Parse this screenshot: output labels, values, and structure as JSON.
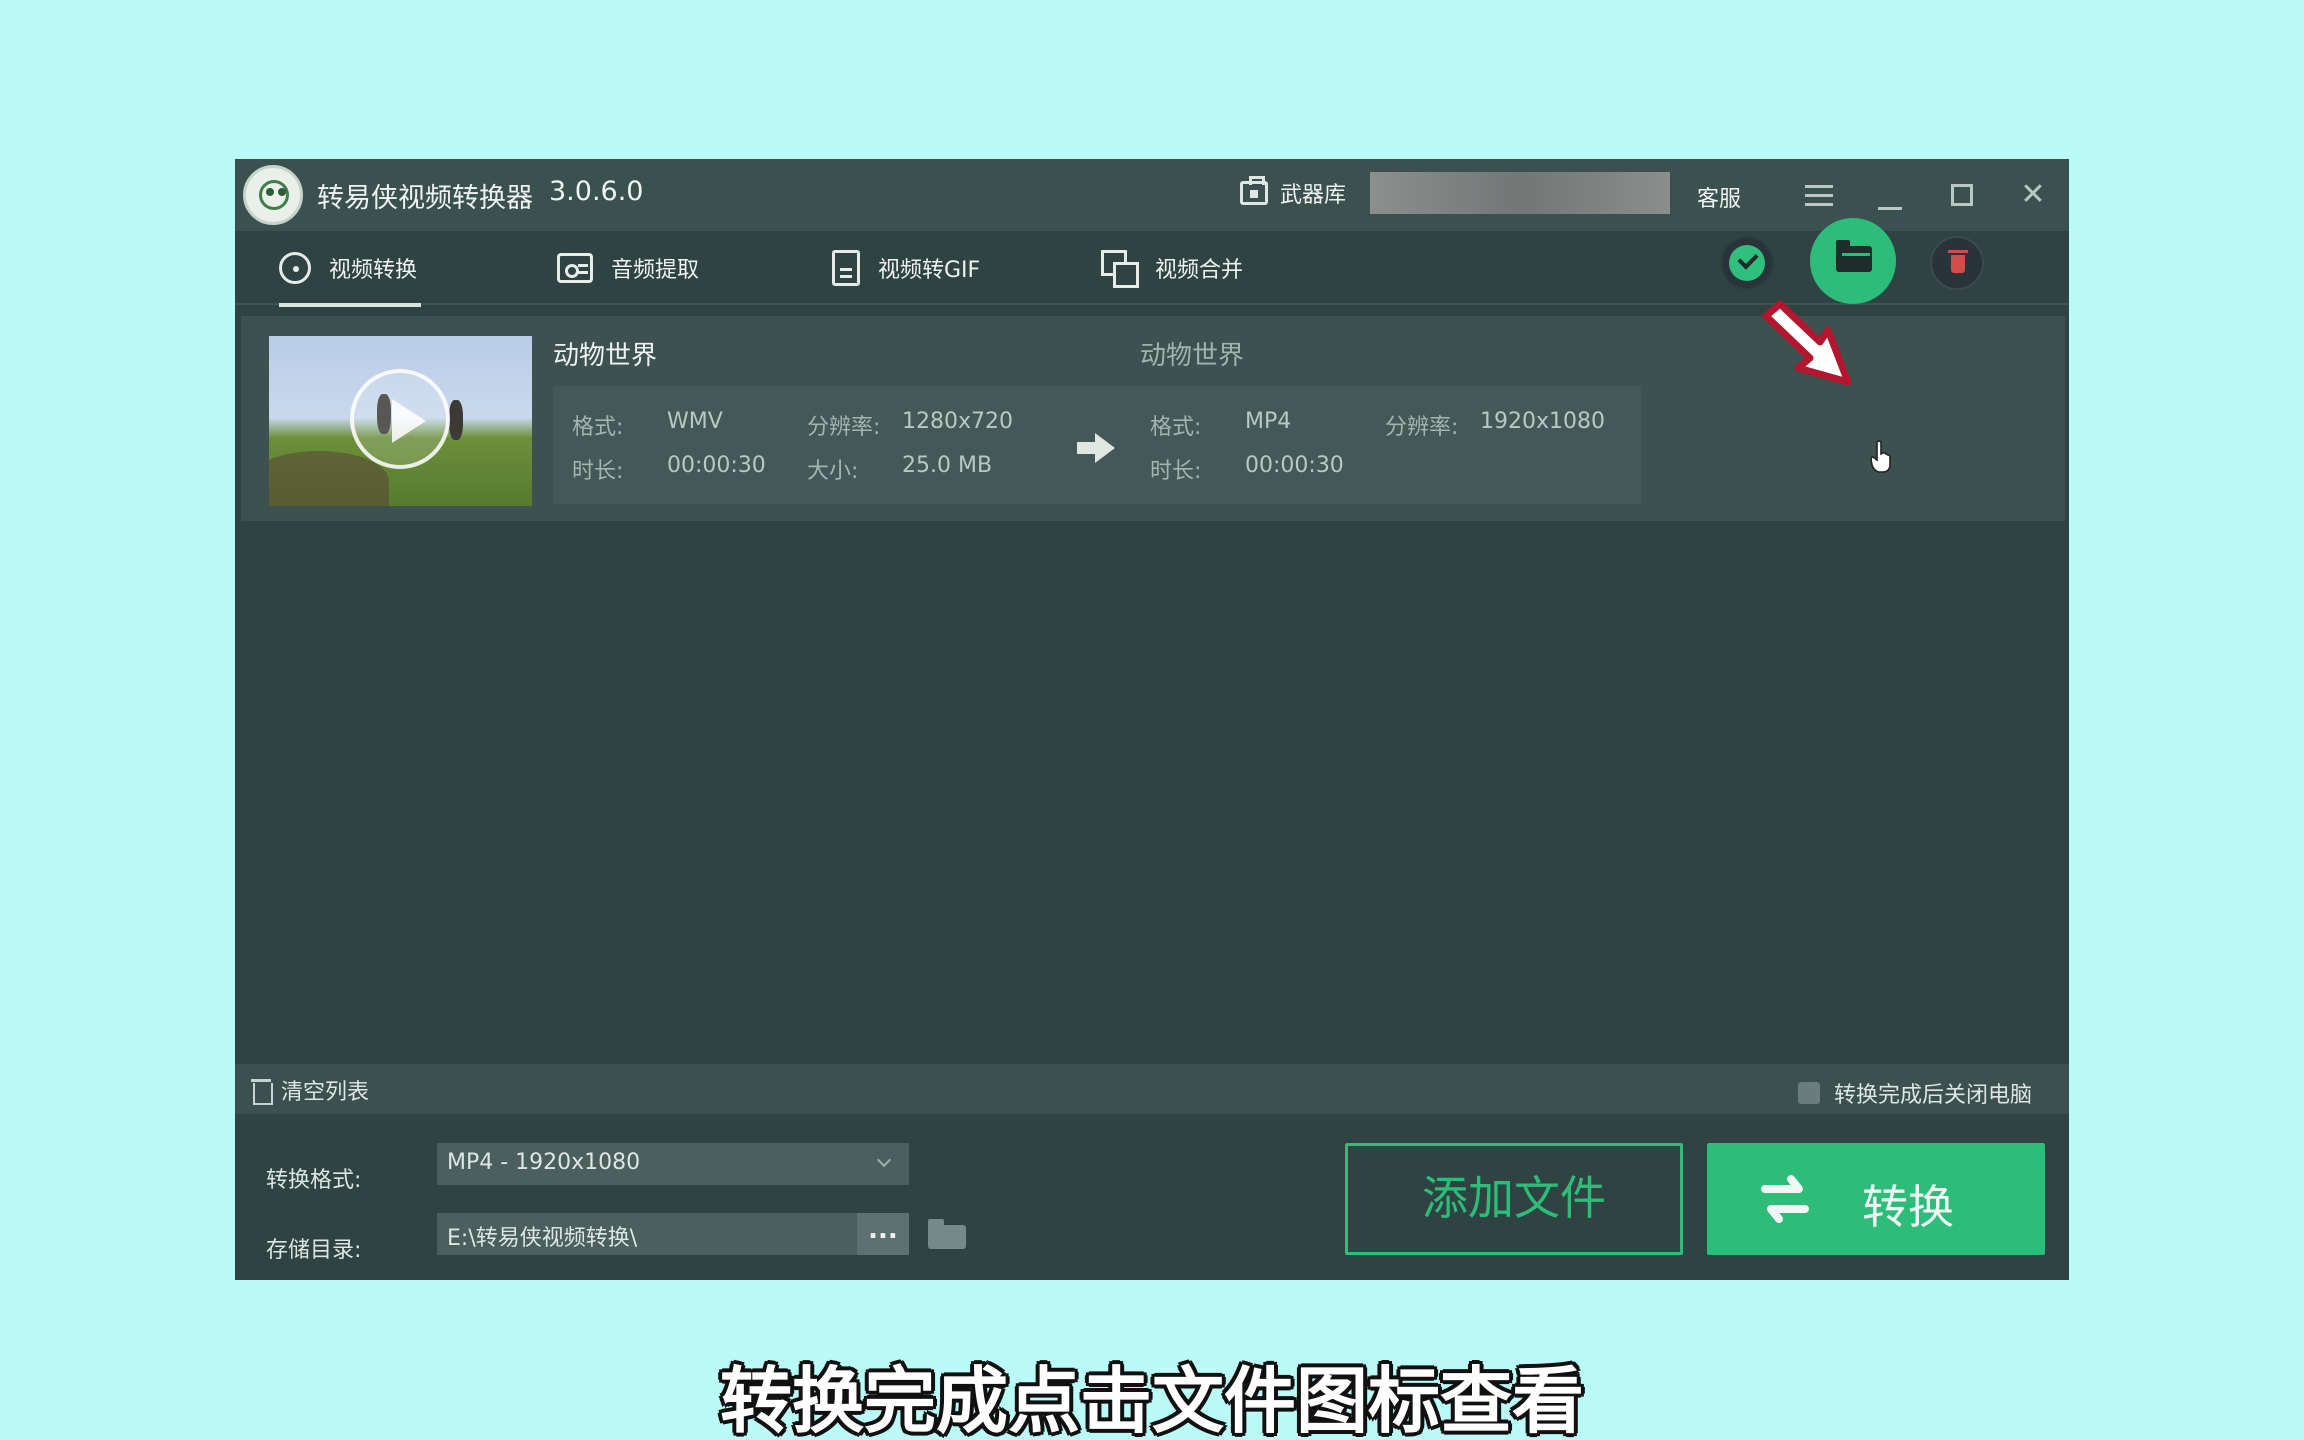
{
  "app": {
    "title": "转易侠视频转换器",
    "version": "3.0.6.0"
  },
  "titlebar": {
    "armory_label": "武器库",
    "service_label": "客服"
  },
  "tabs": [
    {
      "label": "视频转换",
      "icon": "sync-icon",
      "active": true
    },
    {
      "label": "音频提取",
      "icon": "radio-icon",
      "active": false
    },
    {
      "label": "视频转GIF",
      "icon": "document-icon",
      "active": false
    },
    {
      "label": "视频合并",
      "icon": "merge-icon",
      "active": false
    }
  ],
  "file": {
    "source_name": "动物世界",
    "target_name": "动物世界",
    "source": {
      "format_label": "格式:",
      "format": "WMV",
      "resolution_label": "分辨率:",
      "resolution": "1280x720",
      "duration_label": "时长:",
      "duration": "00:00:30",
      "size_label": "大小:",
      "size": "25.0 MB"
    },
    "target": {
      "format_label": "格式:",
      "format": "MP4",
      "resolution_label": "分辨率:",
      "resolution": "1920x1080",
      "duration_label": "时长:",
      "duration": "00:00:30"
    },
    "status": "done"
  },
  "list_toolbar": {
    "clear_label": "清空列表",
    "shutdown_label": "转换完成后关闭电脑",
    "shutdown_checked": false
  },
  "settings": {
    "format_label": "转换格式:",
    "format_value": "MP4 - 1920x1080",
    "dir_label": "存储目录:",
    "dir_value": "E:\\转易侠视频转换\\",
    "browse_label": "..."
  },
  "actions": {
    "add_file": "添加文件",
    "convert": "转换"
  },
  "caption": "转换完成点击文件图标查看",
  "colors": {
    "accent": "#2dbc79",
    "background": "#bafbf8",
    "window": "#2f4342",
    "danger": "#d24d4a"
  }
}
